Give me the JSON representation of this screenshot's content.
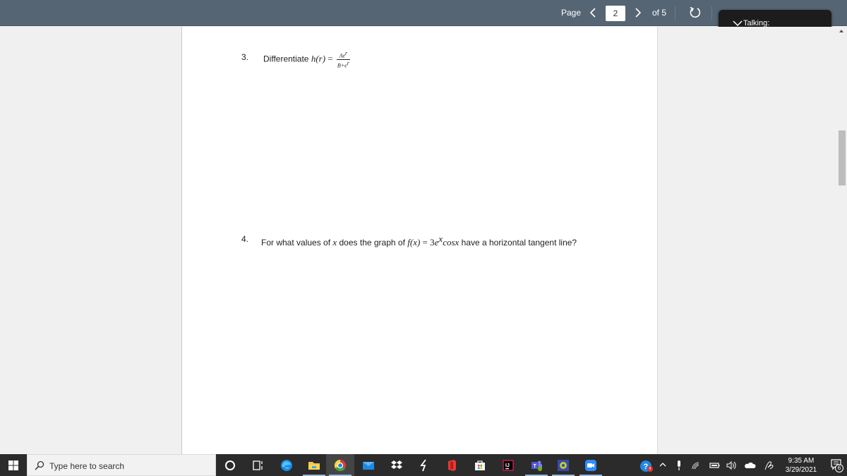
{
  "toolbar": {
    "page_label": "Page",
    "current_page": "2",
    "of_label": "of 5",
    "prev_icon": "chevron-left-icon",
    "next_icon": "chevron-right-icon",
    "rotate_icon": "rotate-icon"
  },
  "talking_overlay": {
    "label": "Talking:",
    "icon": "chevron-down-icon"
  },
  "document": {
    "questions": [
      {
        "number": "3.",
        "prefix": "Differentiate ",
        "func": "h(r)",
        "equals": " = ",
        "numerator": "Ae",
        "numerator_sup": "r",
        "denominator": "B+e",
        "denominator_sup": "r"
      },
      {
        "number": "4.",
        "text_a": "For what values of ",
        "var": "x",
        "text_b": " does the graph of ",
        "func": "f(x)",
        "equals": " = 3",
        "base": "e",
        "exp": "x",
        "trig": "cosx",
        "text_c": " have a horizontal tangent line?"
      }
    ]
  },
  "taskbar": {
    "search_placeholder": "Type here to search",
    "apps": [
      {
        "name": "cortana",
        "icon": "cortana-circle-icon"
      },
      {
        "name": "task-view",
        "icon": "task-view-icon"
      },
      {
        "name": "edge",
        "icon": "edge-icon"
      },
      {
        "name": "file-explorer",
        "icon": "folder-icon"
      },
      {
        "name": "chrome",
        "icon": "chrome-icon"
      },
      {
        "name": "mail",
        "icon": "mail-icon"
      },
      {
        "name": "dropbox",
        "icon": "dropbox-icon"
      },
      {
        "name": "app-lightning",
        "icon": "lightning-icon"
      },
      {
        "name": "office",
        "icon": "office-icon"
      },
      {
        "name": "store",
        "icon": "store-icon"
      },
      {
        "name": "intellij",
        "icon": "intellij-icon"
      },
      {
        "name": "teams",
        "icon": "teams-icon"
      },
      {
        "name": "app-gear",
        "icon": "gear-app-icon"
      },
      {
        "name": "zoom",
        "icon": "zoom-icon"
      }
    ],
    "tray": {
      "time": "9:35 AM",
      "date": "3/29/2021",
      "notification_count": "6"
    }
  },
  "colors": {
    "toolbar_bg": "#566573",
    "taskbar_bg": "#2b2b2b",
    "accent_underline": "#9ab9d6"
  }
}
